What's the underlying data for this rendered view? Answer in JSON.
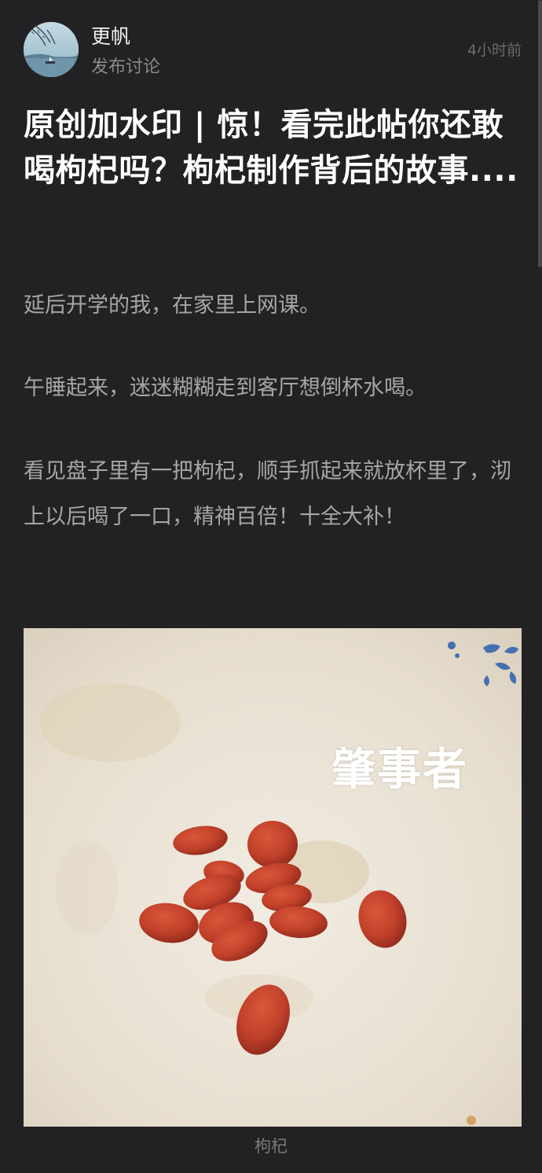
{
  "author": {
    "name": "更帆",
    "action": "发布讨论",
    "time": "4小时前"
  },
  "post": {
    "title": "原创加水印 | 惊！看完此帖你还敢喝枸杞吗？枸杞制作背后的故事....",
    "paragraphs": [
      "延后开学的我，在家里上网课。",
      "午睡起来，迷迷糊糊走到客厅想倒杯水喝。",
      "看见盘子里有一把枸杞，顺手抓起来就放杯里了，沏上以后喝了一口，精神百倍！十全大补！"
    ],
    "image": {
      "watermark": "肇事者",
      "caption": "枸杞"
    }
  },
  "colors": {
    "background": "#222224",
    "title": "#ffffff",
    "body_text": "#a6a6a8",
    "meta_text": "#8a8a8c",
    "goji_red": "#c8442c"
  },
  "icons": {
    "avatar": "landscape-avatar"
  }
}
